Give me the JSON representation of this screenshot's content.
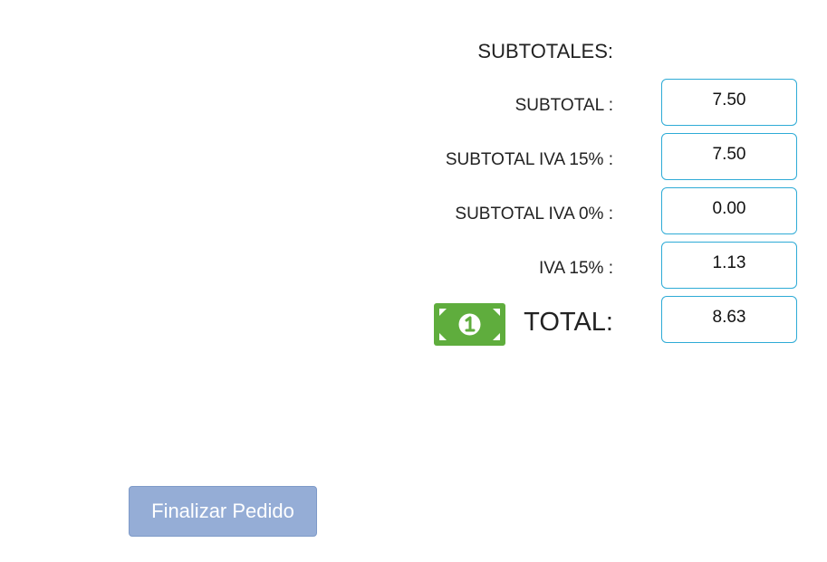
{
  "summary": {
    "heading": "SUBTOTALES:",
    "rows": [
      {
        "label": "SUBTOTAL :",
        "value": "7.50"
      },
      {
        "label": "SUBTOTAL IVA 15% :",
        "value": "7.50"
      },
      {
        "label": "SUBTOTAL IVA 0% :",
        "value": "0.00"
      },
      {
        "label": "IVA 15% :",
        "value": "1.13"
      }
    ],
    "total": {
      "icon": "money-bill-icon",
      "label": "TOTAL:",
      "value": "8.63"
    }
  },
  "actions": {
    "finalize_label": "Finalizar Pedido"
  },
  "colors": {
    "field_border": "#2eabd6",
    "money_icon": "#5fad3d",
    "button_bg": "#95add6"
  }
}
